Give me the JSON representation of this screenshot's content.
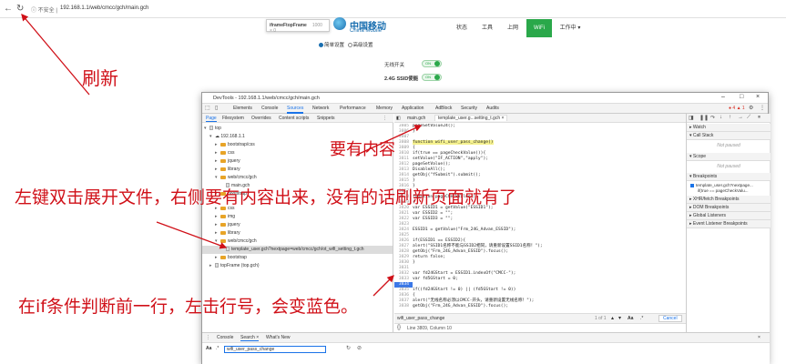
{
  "browser": {
    "back_icon": "back-arrow-icon",
    "refresh_icon": "refresh-icon",
    "secure_label": "不安全",
    "url": "192.168.1.1/web/cmcc/gch/main.gch"
  },
  "router_page": {
    "frame_tooltip_name": "iframeFtopFrame",
    "frame_tooltip_size": "1000 × 0",
    "logo_zh": "中国移动",
    "logo_en": "China Mobile",
    "nav": [
      {
        "label": "状态"
      },
      {
        "label": "工具"
      },
      {
        "label": "上网"
      },
      {
        "label": "WiFi"
      },
      {
        "label": "工作中 ▾"
      }
    ],
    "mode_simple": "简单设置",
    "mode_advanced": "高级设置",
    "wifi_switch_label": "无线开关",
    "ssid_label": "2.4G SSID使能",
    "toggle_on": "ON"
  },
  "devtools": {
    "title": "DevTools - 192.168.1.1/web/cmcc/gch/main.gch",
    "tabs": [
      "Elements",
      "Console",
      "Sources",
      "Network",
      "Performance",
      "Memory",
      "Application",
      "AdBlock",
      "Security",
      "Audits"
    ],
    "error_badge": "● 4 ▲ 1",
    "navigator": {
      "tabs": [
        "Page",
        "Filesystem",
        "Overrides",
        "Content scripts",
        "Snippets"
      ],
      "tree": [
        {
          "label": "top"
        },
        {
          "label": "192.168.1.1"
        },
        {
          "label": "bootstrap/css"
        },
        {
          "label": "css"
        },
        {
          "label": "jquery"
        },
        {
          "label": "library"
        },
        {
          "label": "web/cmcc/gch"
        },
        {
          "label": "main.gch"
        },
        {
          "label": "bootstrap"
        },
        {
          "label": "css"
        },
        {
          "label": "img"
        },
        {
          "label": "jquery"
        },
        {
          "label": "library"
        },
        {
          "label": "web/cmcc/gch"
        },
        {
          "label": "template_user.gch?nextpage=web/cmcc/gch/ot_wifi_setting_t.gch"
        },
        {
          "label": "bootstrap"
        },
        {
          "label": "topFrame (top.gch)"
        }
      ]
    },
    "editor": {
      "tabs": [
        "main.gch",
        "template_user.g...setting_t.gch ×"
      ],
      "lines": [
        {
          "num": "3805",
          "code": "pageSetValue24();"
        },
        {
          "num": "3806",
          "code": "}"
        },
        {
          "num": "3807",
          "code": ""
        },
        {
          "num": "3808",
          "code": "function wifi_user_pass_change()"
        },
        {
          "num": "3809",
          "code": "{"
        },
        {
          "num": "3810",
          "code": "if(true == pageCheckValue()){"
        },
        {
          "num": "3811",
          "code": "setValue(\"IF_ACTION\",\"apply\");"
        },
        {
          "num": "3812",
          "code": "pageSetValue();"
        },
        {
          "num": "3813",
          "code": "DisableAll();"
        },
        {
          "num": "3814",
          "code": "getObj(\"fSubmit\").submit();"
        },
        {
          "num": "3815",
          "code": "}"
        },
        {
          "num": "3816",
          "code": "}"
        },
        {
          "num": "3817",
          "code": ""
        },
        {
          "num": "3818",
          "code": "function pageCheckValue()"
        },
        {
          "num": "3819",
          "code": "{"
        },
        {
          "num": "3820",
          "code": "var ESSID1 = getValue(\"ESSID1\");"
        },
        {
          "num": "3821",
          "code": "var ESSID2 = \"\";"
        },
        {
          "num": "3822",
          "code": "var ESSID3 = \"\";"
        },
        {
          "num": "3823",
          "code": ""
        },
        {
          "num": "3824",
          "code": "ESSID1 = getValue(\"Frm_24G_Advan_ESSID\");"
        },
        {
          "num": "3825",
          "code": ""
        },
        {
          "num": "3826",
          "code": "if(ESSID1 == ESSID2){"
        },
        {
          "num": "3827",
          "code": "alert(\"SSID1名称不能与SSID2相同，请重新设置SSID1名称！\");"
        },
        {
          "num": "3828",
          "code": "getObj(\"Frm_24G_Advan_ESSID\").focus();"
        },
        {
          "num": "3829",
          "code": "return false;"
        },
        {
          "num": "3830",
          "code": "}"
        },
        {
          "num": "3831",
          "code": ""
        },
        {
          "num": "3832",
          "code": "var fd24GStart = ESSID1.indexOf(\"CMCC-\");"
        },
        {
          "num": "3833",
          "code": "var fd5GStart = 0;"
        },
        {
          "num": "3834",
          "code": ""
        },
        {
          "num": "3835",
          "code": "if((fd24GStart != 0) || (fd5GStart != 0))"
        },
        {
          "num": "3836",
          "code": "{"
        },
        {
          "num": "3837",
          "code": "alert(\"无线名称必须以CMCC-开头，请重新设置无线名称！\");"
        },
        {
          "num": "3838",
          "code": "getObj(\"Frm_24G_Advan_ESSID\").focus();"
        }
      ],
      "search_value": "wifi_user_pass_change",
      "search_count": "1 of 1",
      "search_aa": "Aa",
      "search_regex": ".*",
      "cancel_label": "Cancel",
      "status": "Line 3809, Column 10"
    },
    "debugger": {
      "sections": {
        "watch": "▸ Watch",
        "call_stack": "▾ Call Stack",
        "scope": "▾ Scope",
        "breakpoints": "▾ Breakpoints",
        "xhr": "▸ XHR/fetch Breakpoints",
        "dom": "▸ DOM Breakpoints",
        "global": "▸ Global Listeners",
        "event": "▸ Event Listener Breakpoints"
      },
      "not_paused": "Not paused",
      "bp_file": "template_user.gch?nextpage...",
      "bp_code": "if(true == pageCheckValu..."
    },
    "drawer": {
      "tabs": [
        "Console",
        "Search ×",
        "What's New"
      ],
      "aa_label": "Aa",
      "search_value": "wifi_user_pass_change"
    }
  },
  "annotations": {
    "refresh": "刷新",
    "need_content": "要有内容",
    "double_click": "左键双击展开文件，右侧要有内容出来，没有的话刷新页面就有了",
    "breakpoint": "在if条件判断前一行，左击行号，会变蓝色。"
  },
  "colors": {
    "annotation_red": "#d01018",
    "wifi_green": "#2aa84a",
    "breakpoint_blue": "#3b78e7",
    "cmcc_blue": "#1a6fb0"
  }
}
